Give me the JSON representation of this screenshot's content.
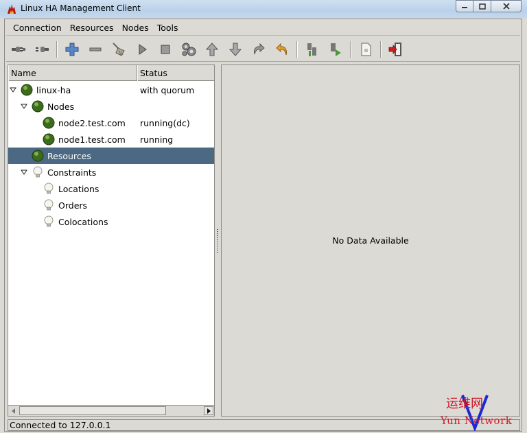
{
  "window": {
    "title": "Linux HA Management Client",
    "buttons": [
      "minimize",
      "maximize",
      "close"
    ]
  },
  "menubar": {
    "items": [
      {
        "label": "Connection"
      },
      {
        "label": "Resources"
      },
      {
        "label": "Nodes"
      },
      {
        "label": "Tools"
      }
    ]
  },
  "toolbar": {
    "icons": [
      "connect-plug-icon",
      "disconnect-plug-icon",
      "add-icon",
      "remove-icon",
      "cleanup-broom-icon",
      "start-icon",
      "stop-icon",
      "gears-icon",
      "up-arrow-icon",
      "down-arrow-icon",
      "redo-icon",
      "undo-icon",
      "standby-icon",
      "active-icon",
      "document-icon",
      "exit-icon"
    ]
  },
  "tree": {
    "columns": {
      "name": "Name",
      "status": "Status"
    },
    "rows": [
      {
        "label": "linux-ha",
        "status": "with quorum",
        "icon": "green-ball-icon",
        "expanded": true
      },
      {
        "label": "Nodes",
        "status": "",
        "icon": "green-ball-icon",
        "expanded": true
      },
      {
        "label": "node2.test.com",
        "status": "running(dc)",
        "icon": "green-ball-icon"
      },
      {
        "label": "node1.test.com",
        "status": "running",
        "icon": "green-ball-icon"
      },
      {
        "label": "Resources",
        "status": "",
        "icon": "green-ball-icon",
        "selected": true
      },
      {
        "label": "Constraints",
        "status": "",
        "icon": "lightbulb-icon",
        "expanded": true
      },
      {
        "label": "Locations",
        "status": "",
        "icon": "lightbulb-icon"
      },
      {
        "label": "Orders",
        "status": "",
        "icon": "lightbulb-icon"
      },
      {
        "label": "Colocations",
        "status": "",
        "icon": "lightbulb-icon"
      }
    ]
  },
  "detail": {
    "message": "No Data Available"
  },
  "statusbar": {
    "text": "Connected to 127.0.0.1"
  },
  "watermark": {
    "cn": "运维网",
    "en": "Yun Network"
  },
  "colors": {
    "selection": "#4b6983",
    "background": "#dcdad5",
    "watermark": "#d0182a"
  }
}
